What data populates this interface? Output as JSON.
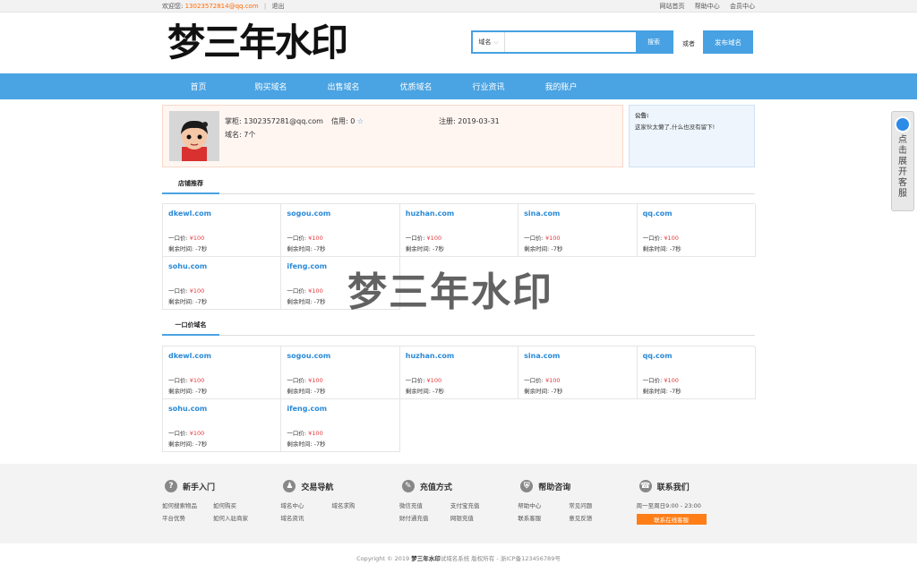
{
  "topbar": {
    "welcome": "欢迎您:",
    "email": "13023572814@qq.com",
    "sep": "|",
    "logout": "退出",
    "links": [
      "网站首页",
      "帮助中心",
      "会员中心"
    ]
  },
  "header": {
    "logo": "梦三年水印",
    "search_select": "域名",
    "search_placeholder": "",
    "search_button": "搜索",
    "or": "或者",
    "publish": "发布域名"
  },
  "nav": [
    "首页",
    "购买域名",
    "出售域名",
    "优质域名",
    "行业资讯",
    "我的账户"
  ],
  "profile": {
    "seller_label": "掌柜: ",
    "seller": "1302357281@qq.com",
    "credit_label": "信用: 0 ",
    "credit_star": "☆",
    "register": "注册: 2019-03-31",
    "domains": "域名: 7个"
  },
  "notice": {
    "title": "公告:",
    "text": "这家伙太懒了,什么也没有留下!"
  },
  "sections": {
    "recommend": "店铺推荐",
    "fixed": "一口价域名"
  },
  "domains": [
    {
      "name": "dkewl.com",
      "price_label": "一口价: ",
      "price": "¥100",
      "time": "剩余时间: -7秒"
    },
    {
      "name": "sogou.com",
      "price_label": "一口价: ",
      "price": "¥100",
      "time": "剩余时间: -7秒"
    },
    {
      "name": "huzhan.com",
      "price_label": "一口价: ",
      "price": "¥100",
      "time": "剩余时间: -7秒"
    },
    {
      "name": "sina.com",
      "price_label": "一口价: ",
      "price": "¥100",
      "time": "剩余时间: -7秒"
    },
    {
      "name": "qq.com",
      "price_label": "一口价: ",
      "price": "¥100",
      "time": "剩余时间: -7秒"
    },
    {
      "name": "sohu.com",
      "price_label": "一口价: ",
      "price": "¥100",
      "time": "剩余时间: -7秒"
    },
    {
      "name": "ifeng.com",
      "price_label": "一口价: ",
      "price": "¥100",
      "time": "剩余时间: -7秒"
    }
  ],
  "watermark": "梦三年水印",
  "footer": {
    "cols": [
      {
        "title": "新手入门",
        "icon": "?",
        "links": [
          "如何搜索物品",
          "如何购买",
          "平台优势",
          "如何入驻商家"
        ]
      },
      {
        "title": "交易导航",
        "icon": "♟",
        "links": [
          "域名中心",
          "域名求购",
          "域名资讯"
        ]
      },
      {
        "title": "充值方式",
        "icon": "✎",
        "links": [
          "微信充值",
          "支付宝充值",
          "财付通充值",
          "网银充值"
        ]
      },
      {
        "title": "帮助咨询",
        "icon": "⛨",
        "links": [
          "帮助中心",
          "常见问题",
          "联系客服",
          "意见反馈"
        ]
      }
    ],
    "contact_title": "联系我们",
    "contact_icon": "☎",
    "hours": "周一至周日9:00 - 23:00",
    "service_button": "联系在线客服"
  },
  "copyright": {
    "prefix": "Copyright © 2019 ",
    "brand": "梦三年水印",
    "suffix": "试域名系统 版权所有 - 浙ICP备123456789号"
  },
  "side": {
    "text": "点击展开客服"
  }
}
